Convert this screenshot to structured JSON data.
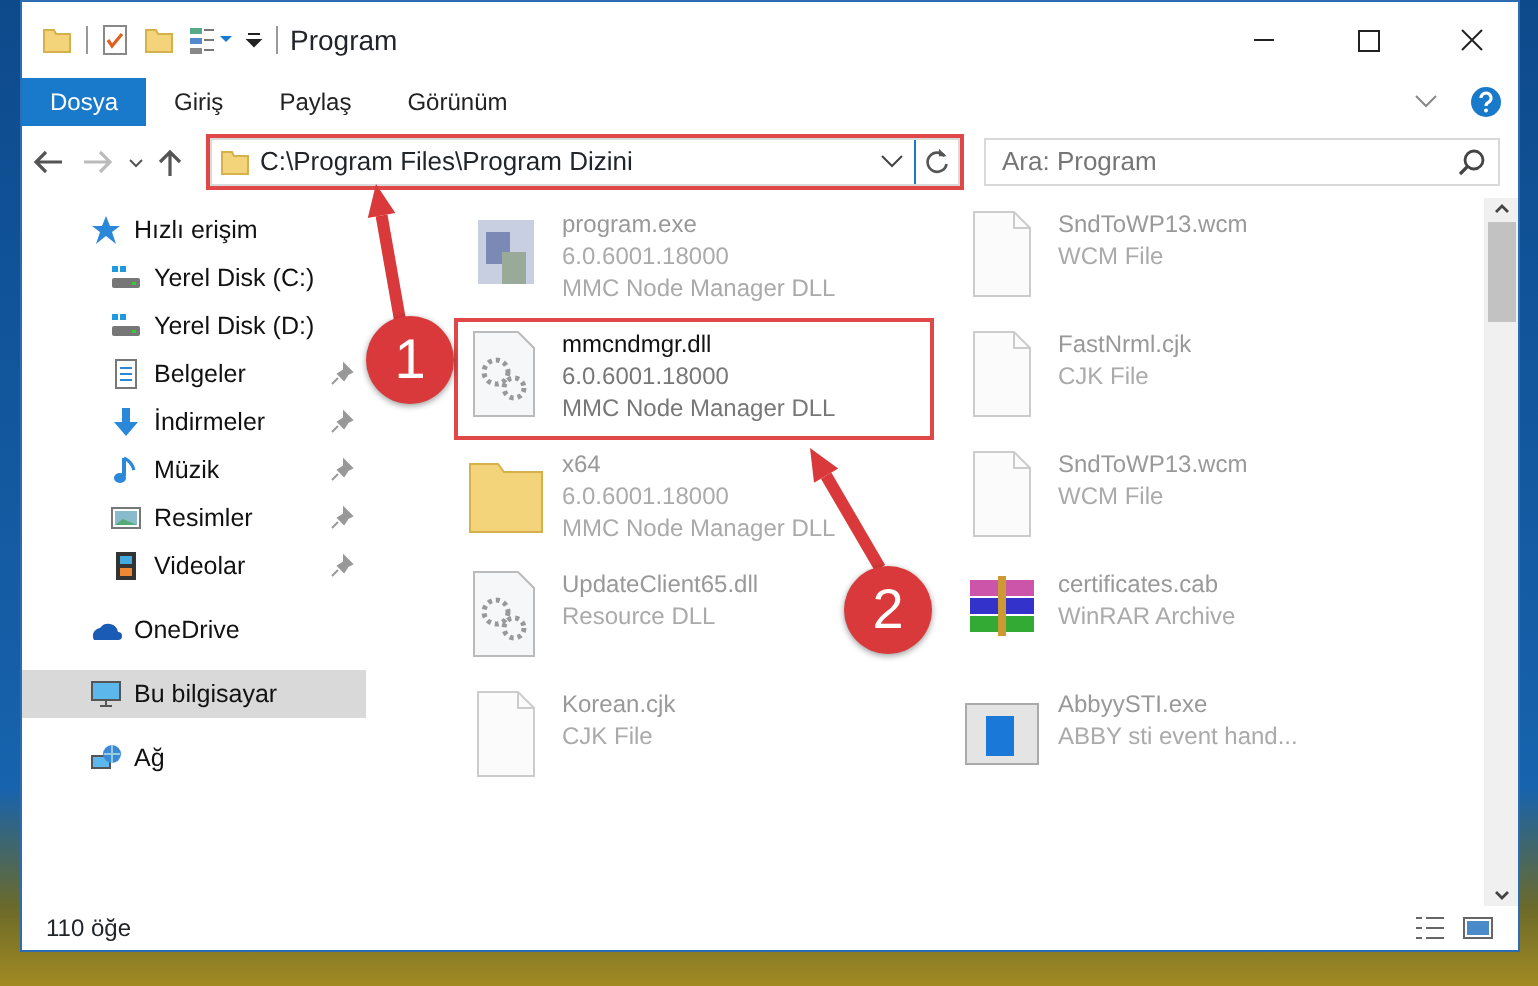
{
  "window": {
    "title": "Program"
  },
  "ribbon_tabs": [
    {
      "label": "Dosya",
      "selected": true
    },
    {
      "label": "Giriş",
      "selected": false
    },
    {
      "label": "Paylaş",
      "selected": false
    },
    {
      "label": "Görünüm",
      "selected": false
    }
  ],
  "address": {
    "path": "C:\\Program Files\\Program Dizini",
    "highlighted": true
  },
  "search": {
    "placeholder": "Ara: Program"
  },
  "sidebar": {
    "items": [
      {
        "label": "Hızlı erişim",
        "kind": "star",
        "selected": false,
        "children": [
          {
            "label": "Yerel Disk (C:)",
            "kind": "disk",
            "pinned": false,
            "selected": false
          },
          {
            "label": "Yerel Disk (D:)",
            "kind": "disk",
            "pinned": false,
            "selected": false
          },
          {
            "label": "Belgeler",
            "kind": "docs",
            "pinned": true,
            "selected": false
          },
          {
            "label": "İndirmeler",
            "kind": "download",
            "pinned": true,
            "selected": false
          },
          {
            "label": "Müzik",
            "kind": "music",
            "pinned": true,
            "selected": false
          },
          {
            "label": "Resimler",
            "kind": "pictures",
            "pinned": true,
            "selected": false
          },
          {
            "label": "Videolar",
            "kind": "videos",
            "pinned": true,
            "selected": false
          }
        ]
      },
      {
        "label": "OneDrive",
        "kind": "cloud",
        "selected": false
      },
      {
        "label": "Bu bilgisayar",
        "kind": "computer",
        "selected": true
      },
      {
        "label": "Ağ",
        "kind": "network",
        "selected": false
      }
    ]
  },
  "files": [
    {
      "name": "program.exe",
      "lines": [
        "6.0.6001.18000",
        "MMC Node Manager DLL"
      ],
      "kind": "exe",
      "highlighted": false
    },
    {
      "name": "SndToWP13.wcm",
      "lines": [
        "WCM File"
      ],
      "kind": "file",
      "highlighted": false
    },
    {
      "name": "mmcndmgr.dll",
      "lines": [
        "6.0.6001.18000",
        "MMC Node Manager DLL"
      ],
      "kind": "dll",
      "highlighted": true
    },
    {
      "name": "FastNrml.cjk",
      "lines": [
        "CJK File"
      ],
      "kind": "file",
      "highlighted": false
    },
    {
      "name": "x64",
      "lines": [
        "6.0.6001.18000",
        "MMC Node Manager DLL"
      ],
      "kind": "folder",
      "highlighted": false
    },
    {
      "name": "SndToWP13.wcm",
      "lines": [
        "WCM File"
      ],
      "kind": "file",
      "highlighted": false
    },
    {
      "name": "UpdateClient65.dll",
      "lines": [
        "Resource DLL"
      ],
      "kind": "dll",
      "highlighted": false
    },
    {
      "name": "certificates.cab",
      "lines": [
        "WinRAR Archive"
      ],
      "kind": "archive",
      "highlighted": false
    },
    {
      "name": "Korean.cjk",
      "lines": [
        "CJK File"
      ],
      "kind": "file",
      "highlighted": false
    },
    {
      "name": "AbbyySTI.exe",
      "lines": [
        "ABBY sti event hand..."
      ],
      "kind": "app",
      "highlighted": false
    }
  ],
  "callouts": [
    {
      "number": "1"
    },
    {
      "number": "2"
    }
  ],
  "status_bar": {
    "count": "110 öğe"
  }
}
